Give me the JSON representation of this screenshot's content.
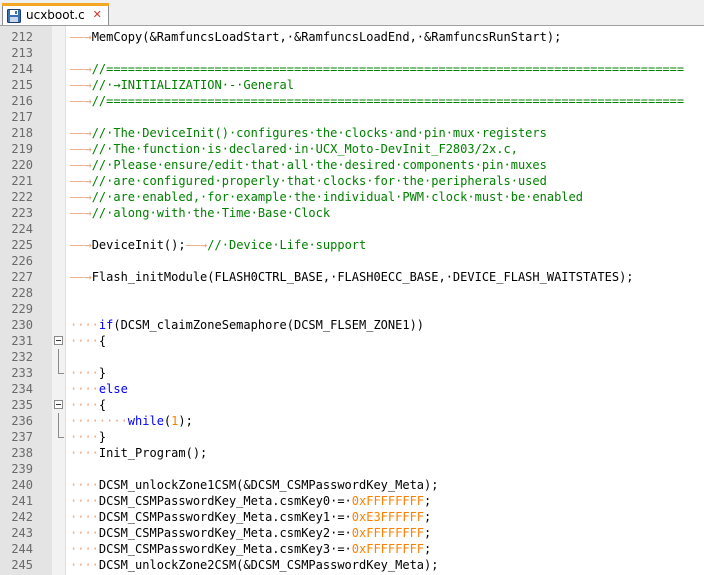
{
  "tab": {
    "title": "ucxboot.c",
    "save_icon": "floppy-disk-icon",
    "close_icon": "close-icon",
    "close_symbol": "✕"
  },
  "colors": {
    "text": "#000000",
    "comment": "#008000",
    "keyword": "#0000ff",
    "number": "#ff8000",
    "whitespace": "#e8a77c",
    "gutter": "#e4e4e4"
  },
  "lines": [
    {
      "n": "212",
      "fold": "",
      "segs": [
        [
          "ws",
          "——→"
        ],
        [
          "text",
          "MemCopy(&RamfuncsLoadStart,·&RamfuncsLoadEnd,·&RamfuncsRunStart);"
        ]
      ]
    },
    {
      "n": "213",
      "fold": "",
      "segs": []
    },
    {
      "n": "214",
      "fold": "",
      "segs": [
        [
          "ws",
          "——→"
        ],
        [
          "comment",
          "//================================================================================"
        ]
      ]
    },
    {
      "n": "215",
      "fold": "",
      "segs": [
        [
          "ws",
          "——→"
        ],
        [
          "comment",
          "//·→INITIALIZATION·-·General"
        ]
      ]
    },
    {
      "n": "216",
      "fold": "",
      "segs": [
        [
          "ws",
          "——→"
        ],
        [
          "comment",
          "//================================================================================"
        ]
      ]
    },
    {
      "n": "217",
      "fold": "",
      "segs": []
    },
    {
      "n": "218",
      "fold": "",
      "segs": [
        [
          "ws",
          "——→"
        ],
        [
          "comment",
          "//·The·DeviceInit()·configures·the·clocks·and·pin·mux·registers"
        ]
      ]
    },
    {
      "n": "219",
      "fold": "",
      "segs": [
        [
          "ws",
          "——→"
        ],
        [
          "comment",
          "//·The·function·is·declared·in·UCX_Moto-DevInit_F2803/2x.c,"
        ]
      ]
    },
    {
      "n": "220",
      "fold": "",
      "segs": [
        [
          "ws",
          "——→"
        ],
        [
          "comment",
          "//·Please·ensure/edit·that·all·the·desired·components·pin·muxes"
        ]
      ]
    },
    {
      "n": "221",
      "fold": "",
      "segs": [
        [
          "ws",
          "——→"
        ],
        [
          "comment",
          "//·are·configured·properly·that·clocks·for·the·peripherals·used"
        ]
      ]
    },
    {
      "n": "222",
      "fold": "",
      "segs": [
        [
          "ws",
          "——→"
        ],
        [
          "comment",
          "//·are·enabled,·for·example·the·individual·PWM·clock·must·be·enabled"
        ]
      ]
    },
    {
      "n": "223",
      "fold": "",
      "segs": [
        [
          "ws",
          "——→"
        ],
        [
          "comment",
          "//·along·with·the·Time·Base·Clock"
        ]
      ]
    },
    {
      "n": "224",
      "fold": "",
      "segs": []
    },
    {
      "n": "225",
      "fold": "",
      "segs": [
        [
          "ws",
          "——→"
        ],
        [
          "text",
          "DeviceInit();"
        ],
        [
          "ws",
          "——→"
        ],
        [
          "comment",
          "//·Device·Life·support"
        ]
      ]
    },
    {
      "n": "226",
      "fold": "",
      "segs": []
    },
    {
      "n": "227",
      "fold": "",
      "segs": [
        [
          "ws",
          "——→"
        ],
        [
          "text",
          "Flash_initModule(FLASH0CTRL_BASE,·FLASH0ECC_BASE,·DEVICE_FLASH_WAITSTATES);"
        ]
      ]
    },
    {
      "n": "228",
      "fold": "",
      "segs": []
    },
    {
      "n": "229",
      "fold": "",
      "segs": []
    },
    {
      "n": "230",
      "fold": "",
      "segs": [
        [
          "ws",
          "····"
        ],
        [
          "kw",
          "if"
        ],
        [
          "text",
          "(DCSM_claimZoneSemaphore(DCSM_FLSEM_ZONE1))"
        ]
      ]
    },
    {
      "n": "231",
      "fold": "box",
      "segs": [
        [
          "ws",
          "····"
        ],
        [
          "text",
          "{"
        ]
      ]
    },
    {
      "n": "232",
      "fold": "line",
      "segs": []
    },
    {
      "n": "233",
      "fold": "end",
      "segs": [
        [
          "ws",
          "····"
        ],
        [
          "text",
          "}"
        ]
      ]
    },
    {
      "n": "234",
      "fold": "",
      "segs": [
        [
          "ws",
          "····"
        ],
        [
          "kw",
          "else"
        ]
      ]
    },
    {
      "n": "235",
      "fold": "box",
      "segs": [
        [
          "ws",
          "····"
        ],
        [
          "text",
          "{"
        ]
      ]
    },
    {
      "n": "236",
      "fold": "line",
      "segs": [
        [
          "ws",
          "········"
        ],
        [
          "kw",
          "while"
        ],
        [
          "text",
          "("
        ],
        [
          "num",
          "1"
        ],
        [
          "text",
          ");"
        ]
      ]
    },
    {
      "n": "237",
      "fold": "end",
      "segs": [
        [
          "ws",
          "····"
        ],
        [
          "text",
          "}"
        ]
      ]
    },
    {
      "n": "238",
      "fold": "",
      "segs": [
        [
          "ws",
          "····"
        ],
        [
          "text",
          "Init_Program();"
        ]
      ]
    },
    {
      "n": "239",
      "fold": "",
      "segs": []
    },
    {
      "n": "240",
      "fold": "",
      "segs": [
        [
          "ws",
          "····"
        ],
        [
          "text",
          "DCSM_unlockZone1CSM(&DCSM_CSMPasswordKey_Meta);"
        ]
      ]
    },
    {
      "n": "241",
      "fold": "",
      "segs": [
        [
          "ws",
          "····"
        ],
        [
          "text",
          "DCSM_CSMPasswordKey_Meta.csmKey0·=·"
        ],
        [
          "num",
          "0xFFFFFFFF"
        ],
        [
          "text",
          ";"
        ]
      ]
    },
    {
      "n": "242",
      "fold": "",
      "segs": [
        [
          "ws",
          "····"
        ],
        [
          "text",
          "DCSM_CSMPasswordKey_Meta.csmKey1·=·"
        ],
        [
          "num",
          "0xE3FFFFFF"
        ],
        [
          "text",
          ";"
        ]
      ]
    },
    {
      "n": "243",
      "fold": "",
      "segs": [
        [
          "ws",
          "····"
        ],
        [
          "text",
          "DCSM_CSMPasswordKey_Meta.csmKey2·=·"
        ],
        [
          "num",
          "0xFFFFFFFF"
        ],
        [
          "text",
          ";"
        ]
      ]
    },
    {
      "n": "244",
      "fold": "",
      "segs": [
        [
          "ws",
          "····"
        ],
        [
          "text",
          "DCSM_CSMPasswordKey_Meta.csmKey3·=·"
        ],
        [
          "num",
          "0xFFFFFFFF"
        ],
        [
          "text",
          ";"
        ]
      ]
    },
    {
      "n": "245",
      "fold": "",
      "segs": [
        [
          "ws",
          "····"
        ],
        [
          "text",
          "DCSM_unlockZone2CSM(&DCSM_CSMPasswordKey_Meta);"
        ]
      ]
    }
  ]
}
